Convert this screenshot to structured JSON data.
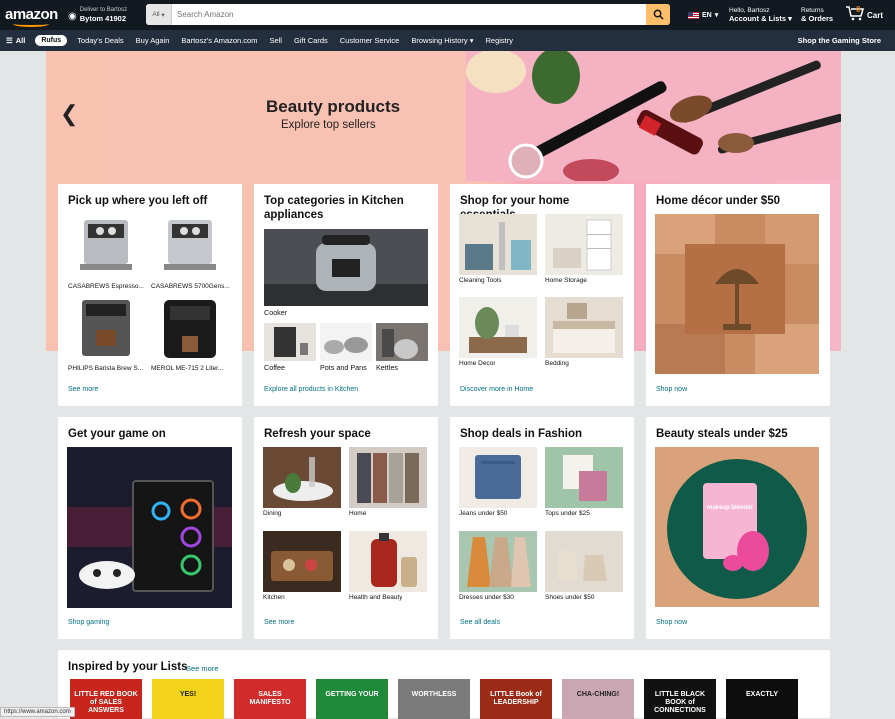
{
  "header": {
    "logo": "amazon",
    "deliver_line1": "Deliver to Bartosz",
    "deliver_line2": "Bytom 41902",
    "search_category": "All",
    "search_placeholder": "Search Amazon",
    "language": "EN",
    "account_line1": "Hello, Bartosz",
    "account_line2": "Account & Lists",
    "orders_line1": "Returns",
    "orders_line2": "& Orders",
    "cart_count": "0",
    "cart_label": "Cart"
  },
  "nav": {
    "all": "All",
    "rufus": "Rufus",
    "items": [
      "Today's Deals",
      "Buy Again",
      "Bartosz's Amazon.com",
      "Sell",
      "Gift Cards",
      "Customer Service",
      "Browsing History",
      "Registry"
    ],
    "right": "Shop the Gaming Store"
  },
  "hero": {
    "title": "Beauty products",
    "subtitle": "Explore top sellers"
  },
  "cards": {
    "resume": {
      "title": "Pick up where you left off",
      "items": [
        "CASABREWS Espresso...",
        "CASABREWS 5700Gens...",
        "PHILIPS Barista Brew S...",
        "MEROL ME-715 2 Liter..."
      ],
      "link": "See more"
    },
    "kitchen": {
      "title": "Top categories in Kitchen appliances",
      "main": "Cooker",
      "items": [
        "Coffee",
        "Pots and Pans",
        "Kettles"
      ],
      "link": "Explore all products in Kitchen"
    },
    "home": {
      "title": "Shop for your home essentials",
      "items": [
        "Cleaning Tools",
        "Home Storage",
        "Home Decor",
        "Bedding"
      ],
      "link": "Discover more in Home"
    },
    "decor": {
      "title": "Home décor under $50",
      "link": "Shop now"
    },
    "game": {
      "title": "Get your game on",
      "link": "Shop gaming"
    },
    "refresh": {
      "title": "Refresh your space",
      "items": [
        "Dining",
        "Home",
        "Kitchen",
        "Health and Beauty"
      ],
      "link": "See more"
    },
    "fashion": {
      "title": "Shop deals in Fashion",
      "items": [
        "Jeans under $50",
        "Tops under $25",
        "Dresses under $30",
        "Shoes under $50"
      ],
      "link": "See all deals"
    },
    "beauty": {
      "title": "Beauty steals under $25",
      "product": "makeup blender",
      "link": "Shop now"
    }
  },
  "inspired": {
    "title": "Inspired by your Lists",
    "see_more": "See more",
    "books": [
      {
        "title": "LITTLE RED BOOK of SALES ANSWERS",
        "color": "#c8261c"
      },
      {
        "title": "YES!",
        "color": "#f2d21b"
      },
      {
        "title": "SALES MANIFESTO",
        "color": "#d12c2c"
      },
      {
        "title": "GETTING YOUR",
        "color": "#1e8a3a"
      },
      {
        "title": "WORTHLESS",
        "color": "#7a7a7a"
      },
      {
        "title": "LITTLE Book of LEADERSHIP",
        "color": "#9b2a16"
      },
      {
        "title": "CHA-CHING!",
        "color": "#c9a6b2"
      },
      {
        "title": "LITTLE BLACK BOOK of CONNECTIONS",
        "color": "#111111"
      },
      {
        "title": "EXACTLY",
        "color": "#0d0d0d"
      }
    ]
  },
  "status_url": "https://www.amazon.com"
}
